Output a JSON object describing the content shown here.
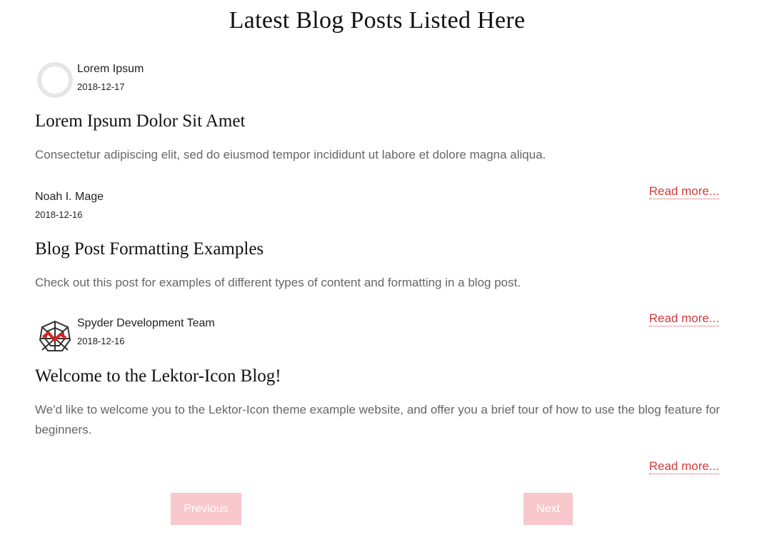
{
  "page": {
    "title": "Latest Blog Posts Listed Here"
  },
  "posts": [
    {
      "author": "Lorem Ipsum",
      "date": "2018-12-17",
      "avatar_icon": "default-user-avatar-icon",
      "title": "Lorem Ipsum Dolor Sit Amet",
      "excerpt": "Consectetur adipiscing elit, sed do eiusmod tempor incididunt ut labore et dolore magna aliqua.",
      "read_more": "Read more..."
    },
    {
      "author": "Noah I. Mage",
      "date": "2018-12-16",
      "avatar_icon": "",
      "title": "Blog Post Formatting Examples",
      "excerpt": "Check out this post for examples of different types of content and formatting in a blog post.",
      "read_more": "Read more..."
    },
    {
      "author": "Spyder Development Team",
      "date": "2018-12-16",
      "avatar_icon": "spyder-web-logo-icon",
      "title": "Welcome to the Lektor-Icon Blog!",
      "excerpt": "We'd like to welcome you to the Lektor-Icon theme example website, and offer you a brief tour of how to use the blog feature for beginners.",
      "read_more": "Read more..."
    }
  ],
  "pagination": {
    "previous_label": "Previous",
    "next_label": "Next"
  },
  "colors": {
    "accent": "#d63a3a",
    "button_bg": "#f9c8cc",
    "excerpt_text": "#666666"
  }
}
